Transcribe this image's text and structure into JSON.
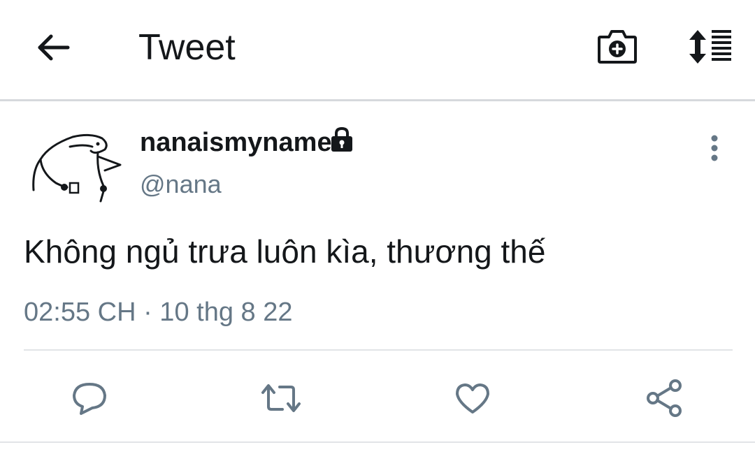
{
  "header": {
    "title": "Tweet",
    "icons": {
      "back": "arrow-left-icon",
      "camera": "camera-plus-icon",
      "thread": "sort-thread-icon"
    }
  },
  "tweet": {
    "author_name": "nanaismyname",
    "author_handle": "@nana",
    "protected_icon": "lock-icon",
    "text": "Không ngủ trưa luôn kìa, thương thế",
    "timestamp": "02:55 CH · 10 thg 8 22",
    "actions": {
      "reply": "reply-icon",
      "retweet": "retweet-icon",
      "like": "heart-icon",
      "share": "share-icon"
    }
  },
  "colors": {
    "text_primary": "#14171a",
    "text_secondary": "#657786",
    "action_icon": "#657786",
    "divider": "#e1e4e7",
    "background": "#ffffff"
  }
}
